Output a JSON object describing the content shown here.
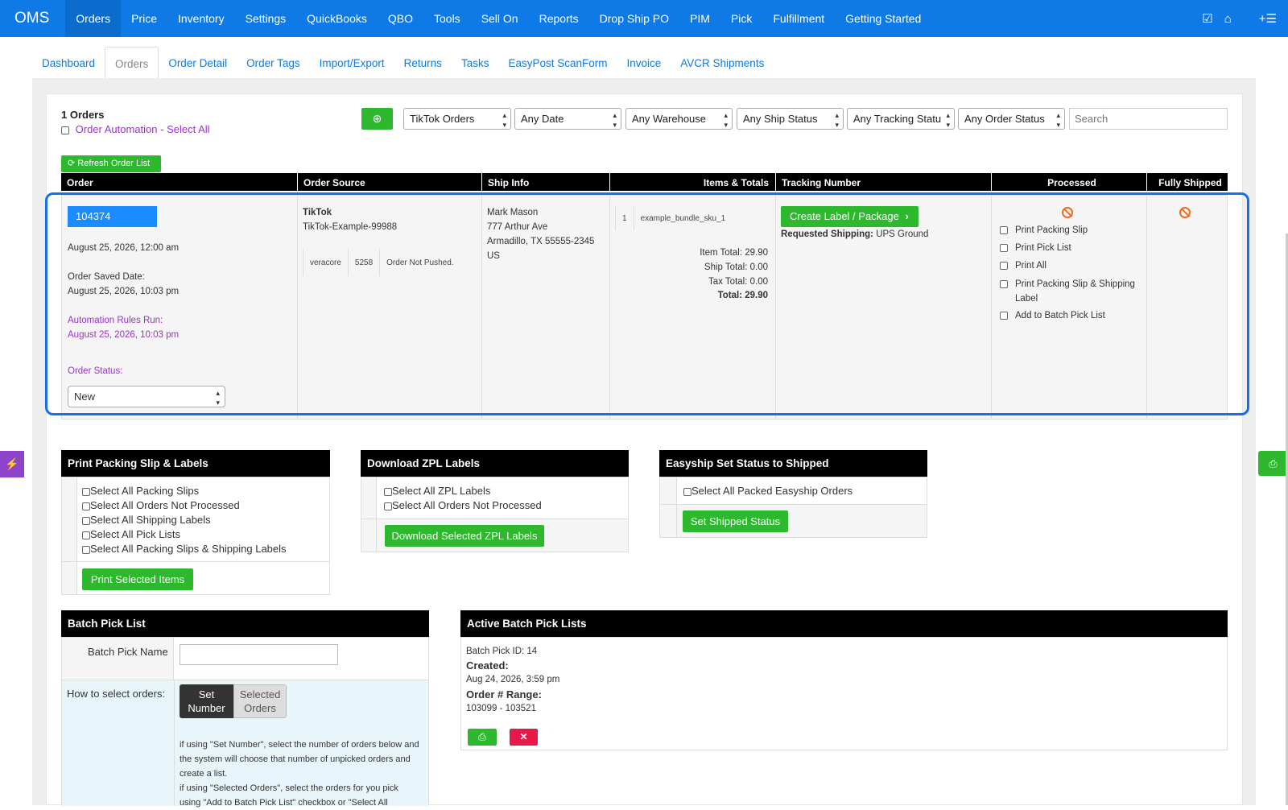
{
  "topnav": {
    "brand": "OMS",
    "items": [
      "Orders",
      "Price",
      "Inventory",
      "Settings",
      "QuickBooks",
      "QBO",
      "Tools",
      "Sell On",
      "Reports",
      "Drop Ship PO",
      "PIM",
      "Pick",
      "Fulfillment",
      "Getting Started"
    ],
    "right_icons": [
      "checklist-icon",
      "home-icon",
      "add-list-icon"
    ]
  },
  "subtabs": [
    "Dashboard",
    "Orders",
    "Order Detail",
    "Order Tags",
    "Import/Export",
    "Returns",
    "Tasks",
    "EasyPost ScanForm",
    "Invoice",
    "AVCR Shipments"
  ],
  "toolbar": {
    "count": "1 Orders",
    "automation_label": "Order Automation - Select All",
    "filters": [
      "TikTok Orders",
      "Any Date",
      "Any Warehouse",
      "Any Ship Status",
      "Any Tracking Statu",
      "Any Order Status"
    ],
    "search_placeholder": "Search",
    "refresh_label": "Refresh Order List"
  },
  "table": {
    "headers": [
      "Order",
      "Order Source",
      "Ship Info",
      "Items & Totals",
      "Tracking Number",
      "Processed",
      "Fully Shipped"
    ],
    "order": {
      "id": "104374",
      "date": "August 25, 2026, 12:00 am",
      "saved_label": "Order Saved Date:",
      "saved_date": "August 25, 2026, 10:03 pm",
      "rules_label": "Automation Rules Run:",
      "rules_date": "August 25, 2026, 10:03 pm",
      "status_label": "Order Status:",
      "status_value": "New"
    },
    "source": {
      "name": "TikTok",
      "ref": "TikTok-Example-99988",
      "push_cells": [
        "veracore",
        "5258",
        "Order Not Pushed."
      ]
    },
    "ship": {
      "name": "Mark Mason",
      "street": "777 Arthur Ave",
      "city": "Armadillo, TX 55555-2345",
      "country": "US"
    },
    "items": {
      "qty": "1",
      "sku": "example_bundle_sku_1",
      "item_total": "Item Total: 29.90",
      "ship_total": "Ship Total: 0.00",
      "tax_total": "Tax Total: 0.00",
      "total": "Total: 29.90"
    },
    "tracking": {
      "button": "Create Label / Package",
      "req_label": "Requested Shipping:",
      "req_value": "UPS Ground"
    },
    "processed": {
      "options": [
        "Print Packing Slip",
        "Print Pick List",
        "Print All",
        "Print Packing Slip & Shipping Label",
        "Add to Batch Pick List"
      ]
    }
  },
  "panels": {
    "print": {
      "title": "Print Packing Slip & Labels",
      "options": [
        "Select All Packing Slips",
        "Select All Orders Not Processed",
        "Select All Shipping Labels",
        "Select All Pick Lists",
        "Select All Packing Slips & Shipping Labels"
      ],
      "button": "Print Selected Items"
    },
    "zpl": {
      "title": "Download ZPL Labels",
      "options": [
        "Select All ZPL Labels",
        "Select All Orders Not Processed"
      ],
      "button": "Download Selected ZPL Labels"
    },
    "easyship": {
      "title": "Easyship Set Status to Shipped",
      "options": [
        "Select All Packed Easyship Orders"
      ],
      "button": "Set Shipped Status"
    },
    "batch": {
      "title": "Batch Pick List",
      "name_label": "Batch Pick Name",
      "how_label": "How to select orders:",
      "toggle": [
        "Set Number",
        "Selected Orders"
      ],
      "help1": "if using \"Set Number\", select the number of orders below and the system will choose that number of unpicked orders and create a list.",
      "help2": "if using \"Selected Orders\", select the orders for you pick using \"Add to Batch Pick List\" checkbox or \"Select All"
    },
    "active": {
      "title": "Active Batch Pick Lists",
      "id_line": "Batch Pick ID: 14",
      "created_label": "Created:",
      "created_value": "Aug 24, 2026, 3:59 pm",
      "range_label": "Order # Range:",
      "range_value": "103099 - 103521"
    }
  },
  "colors": {
    "nav_blue": "#0f7ae5",
    "green": "#2db82d",
    "purple": "#9933cc",
    "orange": "#f26b1d",
    "highlight": "#1a6fe8",
    "danger": "#e8194a"
  }
}
